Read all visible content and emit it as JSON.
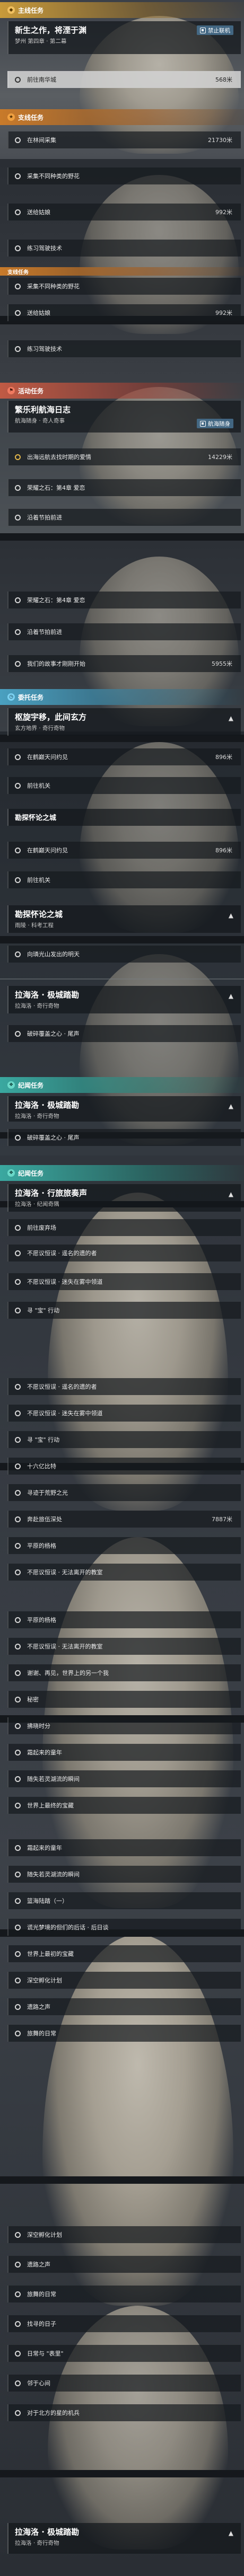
{
  "categories": {
    "main": "主线任务",
    "side": "支线任务",
    "event": "活动任务",
    "daily": "委托任务",
    "legend": "纪闻任务"
  },
  "icons": {
    "main": "diamond-icon",
    "side": "star-icon",
    "event": "flag-icon",
    "daily": "clock-icon",
    "legend": "book-icon"
  },
  "section1": {
    "quest_title": "新生之作，将湮于渊",
    "quest_sub": "梦州 第四章 · 第二幕",
    "badge": "禁止联机",
    "selected_item": "前往南华城",
    "selected_dist": "568米"
  },
  "section2": {
    "items": [
      {
        "label": "在林间采集",
        "dist": "21730米"
      },
      {
        "label": "采集不同种类的野花",
        "dist": ""
      },
      {
        "label": "送给姑娘",
        "dist": "992米"
      },
      {
        "label": "练习驾驶技术",
        "dist": ""
      }
    ]
  },
  "section2b": {
    "items": [
      {
        "label": "采集不同种类的野花",
        "dist": ""
      },
      {
        "label": "送给姑娘",
        "dist": "992米"
      },
      {
        "label": "练习驾驶技术",
        "dist": ""
      }
    ]
  },
  "section3": {
    "quest_title": "繁乐利航海日志",
    "quest_sub": "航海随身 · 奇人奇事",
    "badge": "航海随身",
    "items": [
      {
        "label": "出海远航去找时期的爱情",
        "dist": "14229米"
      },
      {
        "label": "荣耀之石：第4章 爱恋",
        "dist": ""
      },
      {
        "label": "沿着节拍前进",
        "dist": ""
      }
    ]
  },
  "section3b": {
    "items": [
      {
        "label": "荣耀之石：第4章 爱恋",
        "dist": ""
      },
      {
        "label": "沿着节拍前进",
        "dist": ""
      },
      {
        "label": "我们的故事才刚刚开始",
        "dist": "5955米"
      }
    ]
  },
  "section4": {
    "quest_title": "枢旋宇移，此间玄方",
    "quest_sub": "玄方地界 · 奇行奇物",
    "items": [
      {
        "label": "在鹤巅天问约见",
        "dist": "896米"
      },
      {
        "label": "前往机关",
        "dist": ""
      }
    ]
  },
  "section4b": {
    "quest_title": "勘探怀论之城",
    "items": [
      {
        "label": "在鹤巅天问约见",
        "dist": "896米"
      },
      {
        "label": "前往机关",
        "dist": ""
      }
    ]
  },
  "section5": {
    "quest_title": "勘探怀论之城",
    "quest_sub": "雨陵 · 科考工程",
    "items": [
      {
        "label": "向璘光山发出的明天",
        "dist": ""
      }
    ]
  },
  "section6": {
    "quest_title": "拉海洛 · 极城踏勘",
    "quest_sub": "拉海洛 · 奇行奇物",
    "items": [
      {
        "label": "破碎覆盖之心 · 尾声",
        "dist": ""
      }
    ]
  },
  "section6b": {
    "quest_title": "拉海洛 · 极城踏勘",
    "quest_sub": "拉海洛 · 奇行奇物",
    "items": [
      {
        "label": "破碎覆盖之心 · 尾声",
        "dist": ""
      }
    ]
  },
  "section7": {
    "quest_title": "拉海洛 · 行旅旅奏声",
    "quest_sub": "拉海洛 · 纪闻奇隅",
    "items": [
      {
        "label": "前往废弃场",
        "dist": ""
      },
      {
        "label": "不愿议恒误 · 遥名的遗的者",
        "dist": ""
      },
      {
        "label": "不愿议恒误 · 迷失在雾中领道",
        "dist": ""
      },
      {
        "label": "寻 \"宝\" 行动",
        "dist": ""
      }
    ]
  },
  "section7b": {
    "items": [
      {
        "label": "不愿议恒误 · 遥名的遗的者",
        "dist": ""
      },
      {
        "label": "不愿议恒误 · 迷失在雾中领道",
        "dist": ""
      },
      {
        "label": "寻 \"宝\" 行动",
        "dist": ""
      },
      {
        "label": "十六亿比特",
        "dist": ""
      },
      {
        "label": "寻迹于荒野之光",
        "dist": ""
      },
      {
        "label": "奔赴旅伍深处",
        "dist": "7887米"
      },
      {
        "label": "平原的杨格",
        "dist": ""
      },
      {
        "label": "不愿议恒误 · 无法离开的教室",
        "dist": ""
      }
    ]
  },
  "section7c": {
    "items": [
      {
        "label": "平原的杨格",
        "dist": ""
      },
      {
        "label": "不愿议恒误 · 无法离开的教室",
        "dist": ""
      },
      {
        "label": "谢谢、再见，世界上的另一个我",
        "dist": ""
      },
      {
        "label": "秘密",
        "dist": ""
      },
      {
        "label": "拂晓时分",
        "dist": ""
      },
      {
        "label": "霜起来的童年",
        "dist": ""
      },
      {
        "label": "随失若灵湖流的瞬间",
        "dist": ""
      },
      {
        "label": "世界上最终的宝藏",
        "dist": ""
      }
    ]
  },
  "section7d": {
    "items": [
      {
        "label": "霜起来的童年",
        "dist": ""
      },
      {
        "label": "随失若灵湖流的瞬间",
        "dist": ""
      },
      {
        "label": "篮海陆踏（一）",
        "dist": ""
      },
      {
        "label": "谎光梦境的但们的后话 · 后日谈",
        "dist": ""
      },
      {
        "label": "世界上最初的宝藏",
        "dist": ""
      },
      {
        "label": "深空孵化计划",
        "dist": ""
      },
      {
        "label": "遗路之声",
        "dist": ""
      },
      {
        "label": "旅舞的日常",
        "dist": ""
      }
    ]
  },
  "section7e": {
    "items": [
      {
        "label": "深空孵化计划",
        "dist": ""
      },
      {
        "label": "遗路之声",
        "dist": ""
      },
      {
        "label": "旅舞的日常",
        "dist": ""
      },
      {
        "label": "找寻的日子",
        "dist": ""
      },
      {
        "label": "日常与 \"表里\"",
        "dist": ""
      },
      {
        "label": "邻于心间",
        "dist": ""
      },
      {
        "label": "对于北方的星的机兵",
        "dist": ""
      }
    ]
  },
  "section8": {
    "quest_title": "拉海洛 · 极城踏勘",
    "quest_sub": "拉海洛 · 奇行奇物"
  }
}
